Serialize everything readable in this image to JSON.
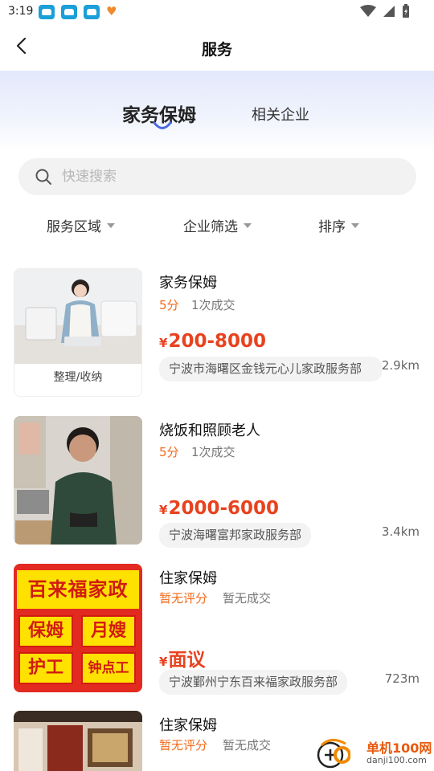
{
  "status": {
    "time": "3:19"
  },
  "nav": {
    "title": "服务"
  },
  "tabs": {
    "active": "家务保姆",
    "other": "相关企业"
  },
  "search": {
    "placeholder": "快速搜索",
    "value": ""
  },
  "filters": [
    "服务区域",
    "企业筛选",
    "排序"
  ],
  "listings": [
    {
      "title": "家务保姆",
      "score": "5分",
      "deals": "1次成交",
      "yen": "¥",
      "price": "200-8000",
      "company": "宁波市海曙区金钱元心儿家政服务部",
      "distance": "2.9km",
      "thumb_caption": "整理/收纳"
    },
    {
      "title": "烧饭和照顾老人",
      "score": "5分",
      "deals": "1次成交",
      "yen": "¥",
      "price": "2000-6000",
      "company": "宁波海曙富邦家政服务部",
      "distance": "3.4km"
    },
    {
      "title": "住家保姆",
      "score": "暂无评分",
      "deals": "暂无成交",
      "yen": "¥",
      "price": "面议",
      "company": "宁波鄞州宁东百来福家政服务部",
      "distance": "723m",
      "thumb_banner": "百来福家政",
      "thumb_tags": [
        "保姆",
        "月嫂",
        "护工",
        "钟点工"
      ]
    },
    {
      "title": "住家保姆",
      "score": "暂无评分",
      "deals": "暂无成交"
    }
  ],
  "watermark": {
    "name": "单机100网",
    "url": "danji100.com"
  },
  "colors": {
    "accent": "#4a67e6",
    "price": "#e8421f",
    "score": "#f36b1c"
  }
}
